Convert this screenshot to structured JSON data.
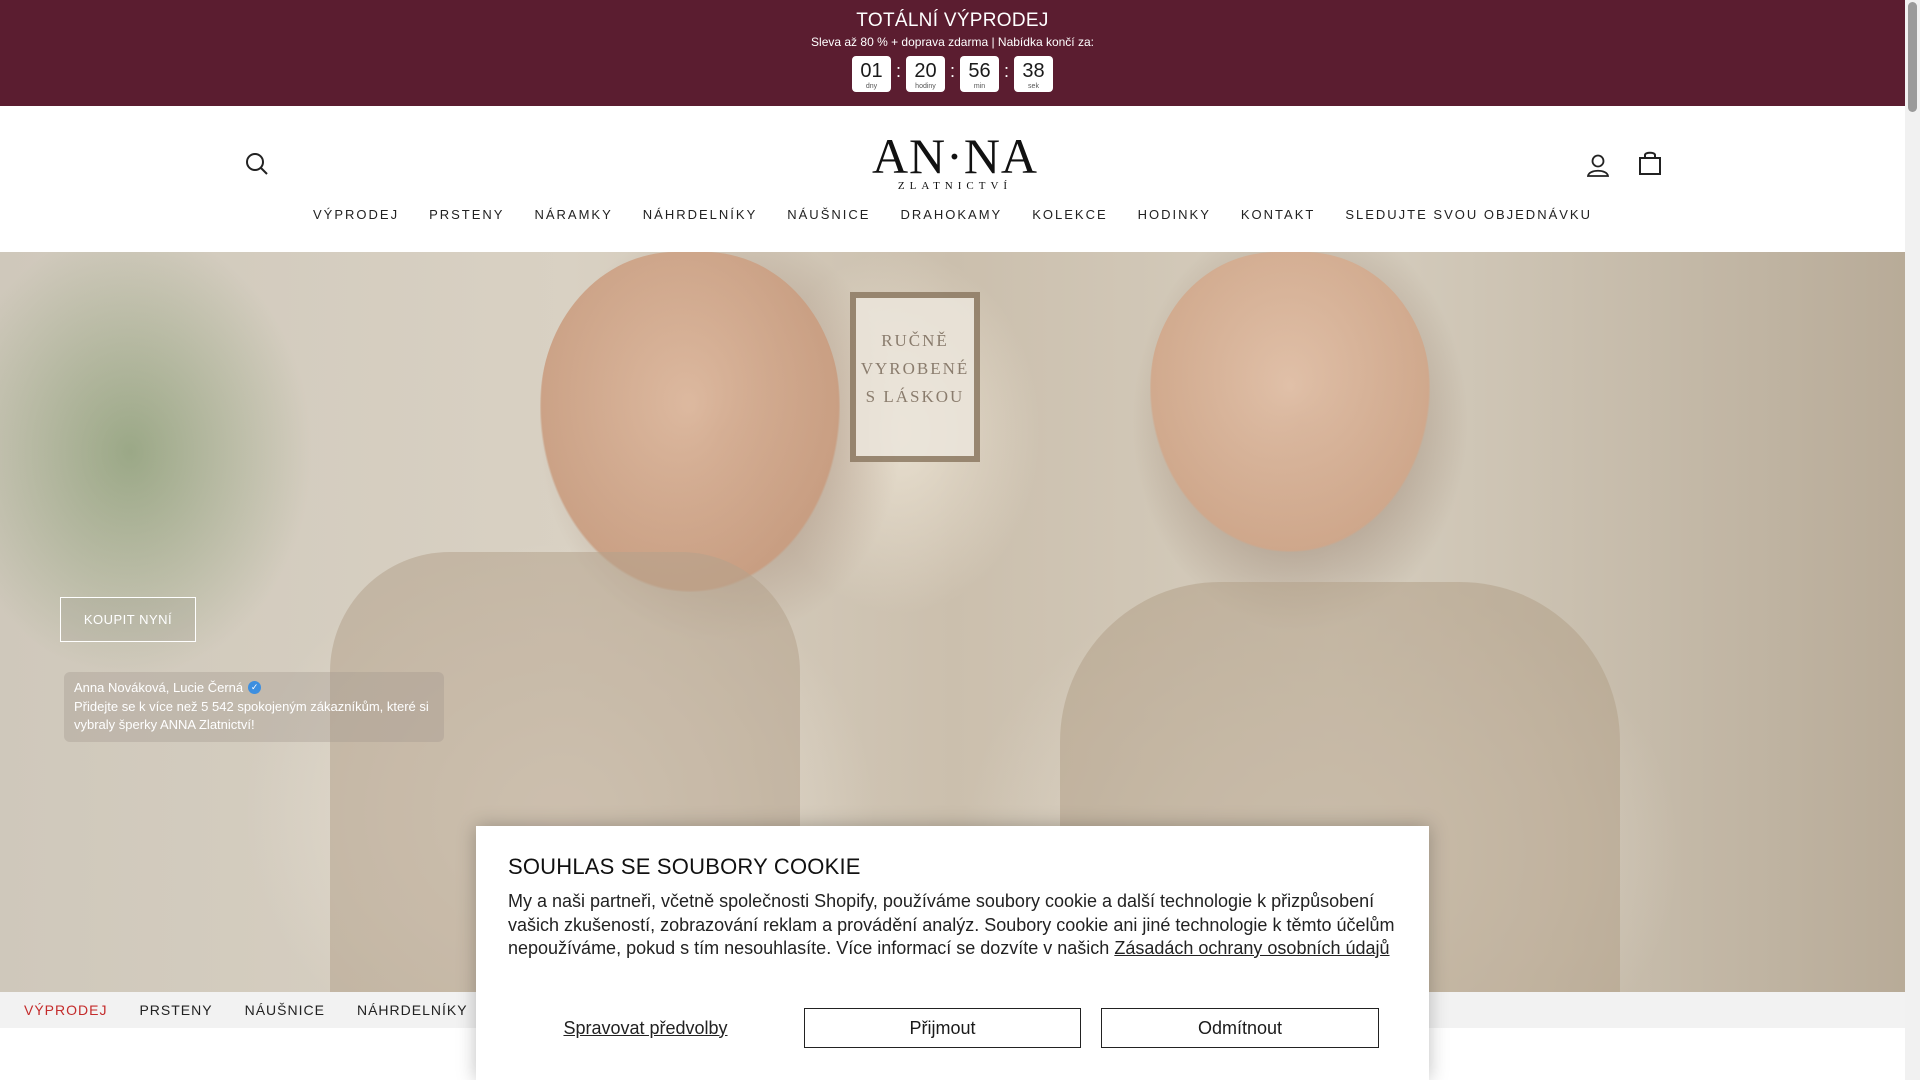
{
  "announcement": {
    "title": "TOTÁLNÍ VÝPRODEJ",
    "subtitle": "Sleva až 80 % + doprava zdarma | Nabídka končí za:",
    "countdown": [
      {
        "value": "01",
        "label": "dny"
      },
      {
        "value": "20",
        "label": "hodiny"
      },
      {
        "value": "56",
        "label": "min"
      },
      {
        "value": "38",
        "label": "sek"
      }
    ],
    "separator": ":",
    "background_color": "#5b1d30"
  },
  "header": {
    "logo_main": "AN·NA",
    "logo_sub": "ZLATNICTVÍ",
    "search_icon": "search-icon",
    "account_icon": "user-icon",
    "cart_icon": "shopping-bag-icon"
  },
  "nav": {
    "items": [
      "VÝPRODEJ",
      "PRSTENY",
      "NÁRAMKY",
      "NÁHRDELNÍKY",
      "NÁUŠNICE",
      "DRAHOKAMY",
      "KOLEKCE",
      "HODINKY",
      "KONTAKT",
      "SLEDUJTE SVOU OBJEDNÁVKU"
    ]
  },
  "hero": {
    "frame_text_1": "RUČNĚ",
    "frame_text_2": "VYROBENÉ",
    "frame_text_3": "S LÁSKOU",
    "cta_label": "KOUPIT NYNÍ",
    "social_names": "Anna Nováková, Lucie Černá",
    "social_text": "Přidejte se k více než 5 542 spokojeným zákazníkům, které si vybraly šperky ANNA Zlatnictví!",
    "verified_icon": "verified-badge-icon"
  },
  "category_bar": {
    "items": [
      "VÝPRODEJ",
      "PRSTENY",
      "NÁUŠNICE",
      "NÁHRDELNÍKY"
    ],
    "sale_color": "#c42b2b"
  },
  "cookie": {
    "title": "SOUHLAS SE SOUBORY COOKIE",
    "body": "My a naši partneři, včetně společnosti Shopify, používáme soubory cookie a další technologie k přizpůsobení vašich zkušeností, zobrazování reklam a provádění analýz. Soubory cookie ani jiné technologie k těmto účelům nepoužíváme, pokud s tím nesouhlasíte. Více informací se dozvíte v našich",
    "policy_link": "Zásadách ochrany osobních údajů",
    "manage_label": "Spravovat předvolby",
    "accept_label": "Přijmout",
    "decline_label": "Odmítnout"
  }
}
